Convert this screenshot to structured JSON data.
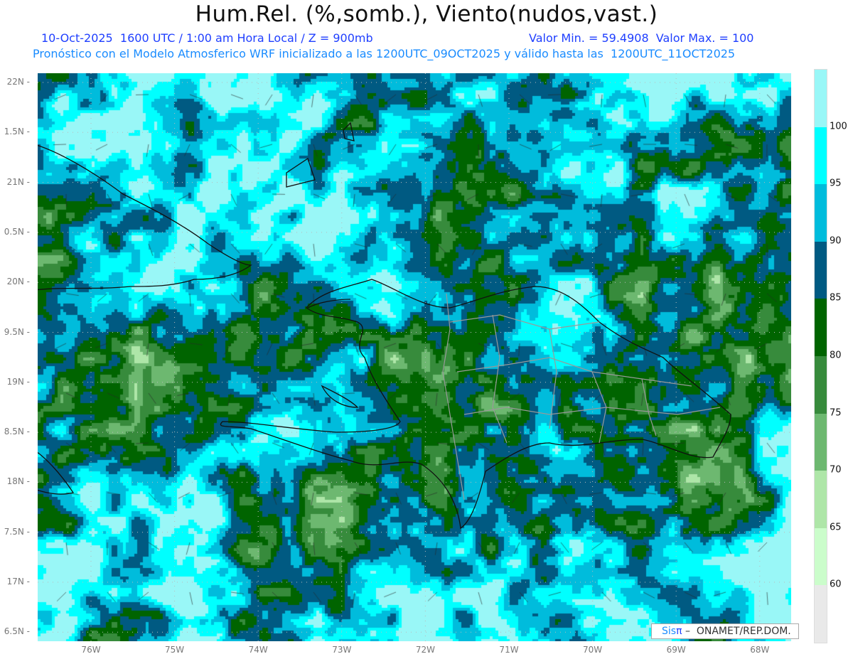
{
  "header": {
    "title": "Hum.Rel. (%,somb.), Viento(nudos,vast.)",
    "subtitle_left": "10-Oct-2025  1600 UTC / 1:00 am Hora Local / Z = 900mb",
    "subtitle_right": "Valor Min. = 59.4908  Valor Max. = 100",
    "subtitle_2": "Pronóstico con el Modelo Atmosferico WRF inicializado a las 1200UTC_09OCT2025 y válido hasta las  1200UTC_11OCT2025"
  },
  "axes": {
    "lat_labels": [
      "22N",
      "1.5N",
      "21N",
      "0.5N",
      "20N",
      "9.5N",
      "19N",
      "8.5N",
      "18N",
      "7.5N",
      "17N",
      "6.5N"
    ],
    "lon_labels": [
      "76W",
      "75W",
      "74W",
      "73W",
      "72W",
      "71W",
      "70W",
      "69W",
      "68W"
    ]
  },
  "colorbar": {
    "labels": [
      "100",
      "95",
      "90",
      "85",
      "80",
      "75",
      "70",
      "65",
      "60"
    ],
    "colors": [
      "#99f7f7",
      "#00ffff",
      "#00bcdc",
      "#005a82",
      "#006400",
      "#378b3c",
      "#6db870",
      "#aee6a8",
      "#cbfdcb",
      "#e9e9e9"
    ]
  },
  "credit": {
    "sis": "Sis",
    "pi": "π",
    "text": " –  ONAMET/REP.DOM."
  }
}
